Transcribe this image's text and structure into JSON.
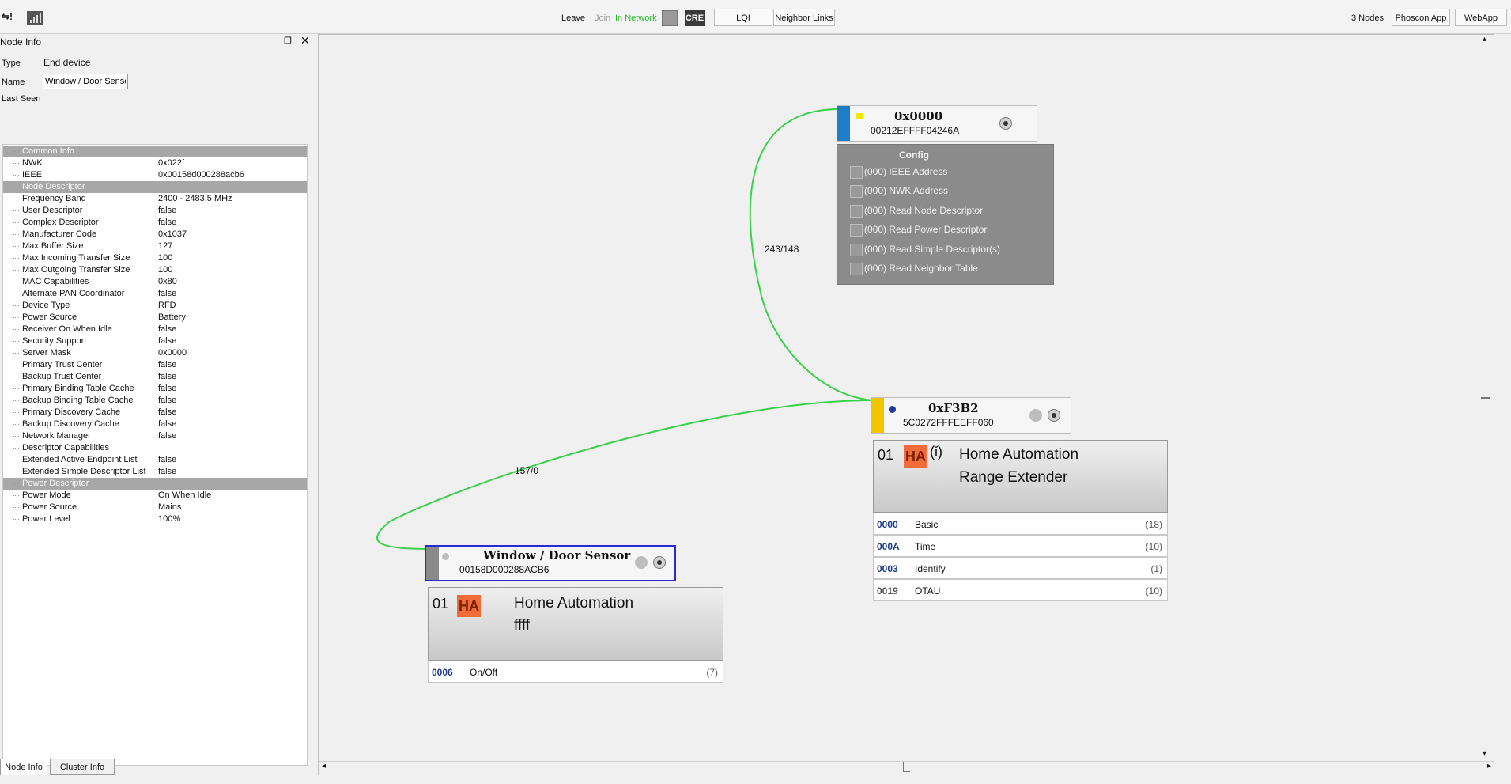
{
  "toolbar": {
    "leave": "Leave",
    "join": "Join",
    "in_network": "In Network",
    "cre": "CRE",
    "lqi": "LQI",
    "neighbor_links": "Neighbor Links",
    "nodes_count": "3 Nodes",
    "phoscon_app": "Phoscon App",
    "webapp": "WebApp",
    "colors": {
      "in_network": "#29b829",
      "link": "#3ad14a"
    }
  },
  "node_info": {
    "title": "Node Info",
    "type_label": "Type",
    "type_value": "End device",
    "name_label": "Name",
    "name_value": "Window / Door Sensor",
    "last_seen_label": "Last Seen",
    "rows": [
      {
        "k": "Common Info",
        "v": "",
        "head": true
      },
      {
        "k": "NWK",
        "v": "0x022f"
      },
      {
        "k": "IEEE",
        "v": "0x00158d000288acb6"
      },
      {
        "k": "Node Descriptor",
        "v": "",
        "head": true
      },
      {
        "k": "Frequency Band",
        "v": "2400 - 2483.5 MHz"
      },
      {
        "k": "User Descriptor",
        "v": "false"
      },
      {
        "k": "Complex Descriptor",
        "v": "false"
      },
      {
        "k": "Manufacturer Code",
        "v": "0x1037"
      },
      {
        "k": "Max Buffer Size",
        "v": "127"
      },
      {
        "k": "Max Incoming Transfer Size",
        "v": "100"
      },
      {
        "k": "Max Outgoing Transfer Size",
        "v": "100"
      },
      {
        "k": "MAC Capabilities",
        "v": "0x80"
      },
      {
        "k": "Alternate PAN Coordinator",
        "v": "false"
      },
      {
        "k": "Device Type",
        "v": "RFD"
      },
      {
        "k": "Power Source",
        "v": "Battery"
      },
      {
        "k": "Receiver On When Idle",
        "v": "false"
      },
      {
        "k": "Security Support",
        "v": "false"
      },
      {
        "k": "Server Mask",
        "v": "0x0000"
      },
      {
        "k": "Primary Trust Center",
        "v": "false"
      },
      {
        "k": "Backup Trust Center",
        "v": "false"
      },
      {
        "k": "Primary Binding Table Cache",
        "v": "false"
      },
      {
        "k": "Backup Binding Table Cache",
        "v": "false"
      },
      {
        "k": "Primary Discovery Cache",
        "v": "false"
      },
      {
        "k": "Backup Discovery Cache",
        "v": "false"
      },
      {
        "k": "Network Manager",
        "v": "false"
      },
      {
        "k": "Descriptor Capabilities",
        "v": ""
      },
      {
        "k": "Extended Active Endpoint List",
        "v": "false"
      },
      {
        "k": "Extended Simple Descriptor List",
        "v": "false"
      },
      {
        "k": "Power Descriptor",
        "v": "",
        "head": true
      },
      {
        "k": "Power Mode",
        "v": "On When Idle"
      },
      {
        "k": "Power Source",
        "v": "Mains"
      },
      {
        "k": "Power Level",
        "v": "100%"
      }
    ],
    "tabs": [
      "Node Info",
      "Cluster Info"
    ]
  },
  "graph": {
    "link_top": "243/148",
    "link_bottom": "157/0",
    "coordinator": {
      "title": "0x0000",
      "addr": "00212EFFFF04246A",
      "config_title": "Config",
      "config_items": [
        "(000) IEEE Address",
        "(000) NWK Address",
        "(000) Read Node Descriptor",
        "(000) Read Power Descriptor",
        "(000) Read Simple Descriptor(s)",
        "(000) Read Neighbor Table"
      ]
    },
    "router": {
      "title": "0xF3B2",
      "addr": "5C0272FFFEEFF060",
      "ep_num": "01",
      "ep_badge": "HA",
      "ep_title1": "Home Automation",
      "ep_title2": "Range Extender",
      "clusters": [
        {
          "id": "0000",
          "name": "Basic",
          "count": "(18)"
        },
        {
          "id": "000A",
          "name": "Time",
          "count": "(10)"
        },
        {
          "id": "0003",
          "name": "Identify",
          "count": "(1)"
        },
        {
          "id": "0019",
          "name": "OTAU",
          "count": "(10)"
        }
      ]
    },
    "sensor": {
      "title": "Window / Door Sensor",
      "addr": "00158D000288ACB6",
      "ep_num": "01",
      "ep_badge": "HA",
      "ep_title1": "Home Automation",
      "ep_title2": "ffff",
      "clusters": [
        {
          "id": "0006",
          "name": "On/Off",
          "count": "(7)"
        }
      ]
    }
  }
}
